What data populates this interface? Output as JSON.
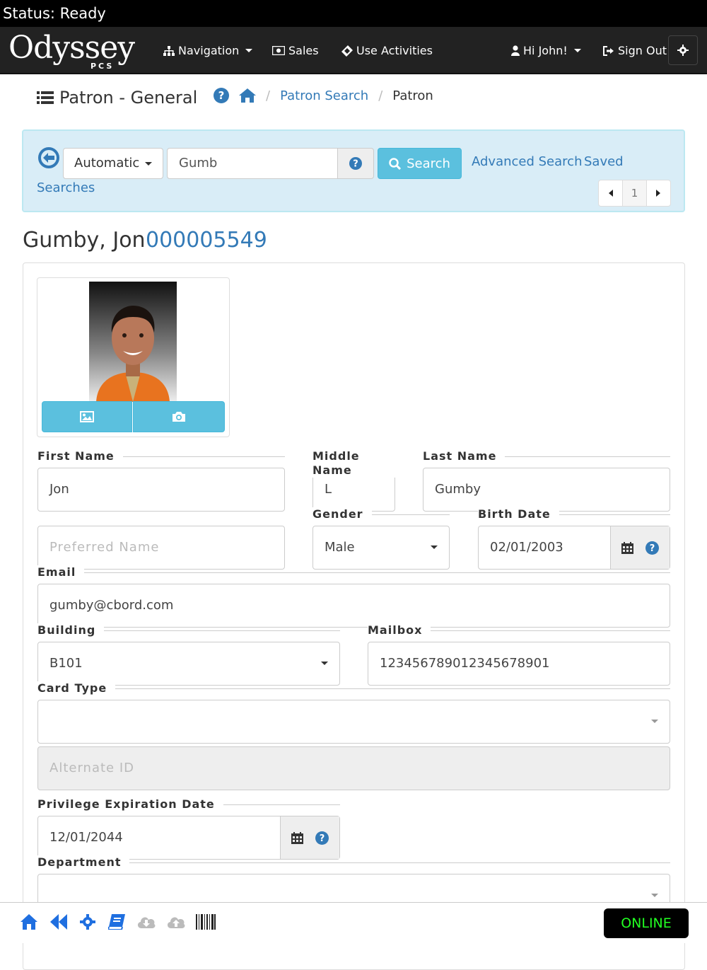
{
  "status_bar": {
    "text": "Status: Ready"
  },
  "navbar": {
    "logo": "Odyssey",
    "logo_sub": "PCS",
    "items": [
      {
        "label": "Navigation",
        "icon": "sitemap-icon"
      },
      {
        "label": "Sales",
        "icon": "money-icon"
      },
      {
        "label": "Use Activities",
        "icon": "ticket-icon"
      },
      {
        "label": "Hi John!",
        "icon": "user-icon"
      },
      {
        "label": "Sign Out",
        "icon": "sign-out-icon"
      }
    ],
    "settings_icon": "gear-icon"
  },
  "header": {
    "title": "Patron - General",
    "breadcrumb": [
      "Patron Search",
      "Patron"
    ]
  },
  "search": {
    "mode": "Automatic",
    "query": "Gumb",
    "search_label": "Search",
    "advanced_label": "Advanced Search",
    "saved_label": "Saved",
    "saved_label_2": "Searches",
    "page": "1"
  },
  "patron": {
    "name": "Gumby, Jon",
    "id": "000005549"
  },
  "form": {
    "first_name": {
      "label": "First Name",
      "value": "Jon"
    },
    "middle_name": {
      "label": "Middle Name",
      "value": "L"
    },
    "last_name": {
      "label": "Last Name",
      "value": "Gumby"
    },
    "preferred_name": {
      "label": "",
      "placeholder": "Preferred Name"
    },
    "gender": {
      "label": "Gender",
      "value": "Male"
    },
    "birth_date": {
      "label": "Birth Date",
      "value": "02/01/2003"
    },
    "email": {
      "label": "Email",
      "value": "gumby@cbord.com"
    },
    "building": {
      "label": "Building",
      "value": "B101"
    },
    "mailbox": {
      "label": "Mailbox",
      "value": "12345678901234567890​1"
    },
    "card_type": {
      "label": "Card Type",
      "value": ""
    },
    "alternate_id": {
      "placeholder": "Alternate ID"
    },
    "privilege_expiration": {
      "label": "Privilege Expiration Date",
      "value": "12/01/2044"
    },
    "department": {
      "label": "Department",
      "value": ""
    }
  },
  "footer": {
    "online_label": "ONLINE",
    "icons": [
      "home-icon",
      "fast-backward-icon",
      "gear-icon",
      "book-icon",
      "cloud-download-icon",
      "cloud-upload-icon",
      "barcode-icon"
    ]
  },
  "colors": {
    "accent": "#337ab7",
    "info": "#5bc0de",
    "panel_bg": "#d9edf7",
    "online": "#22ff22"
  }
}
